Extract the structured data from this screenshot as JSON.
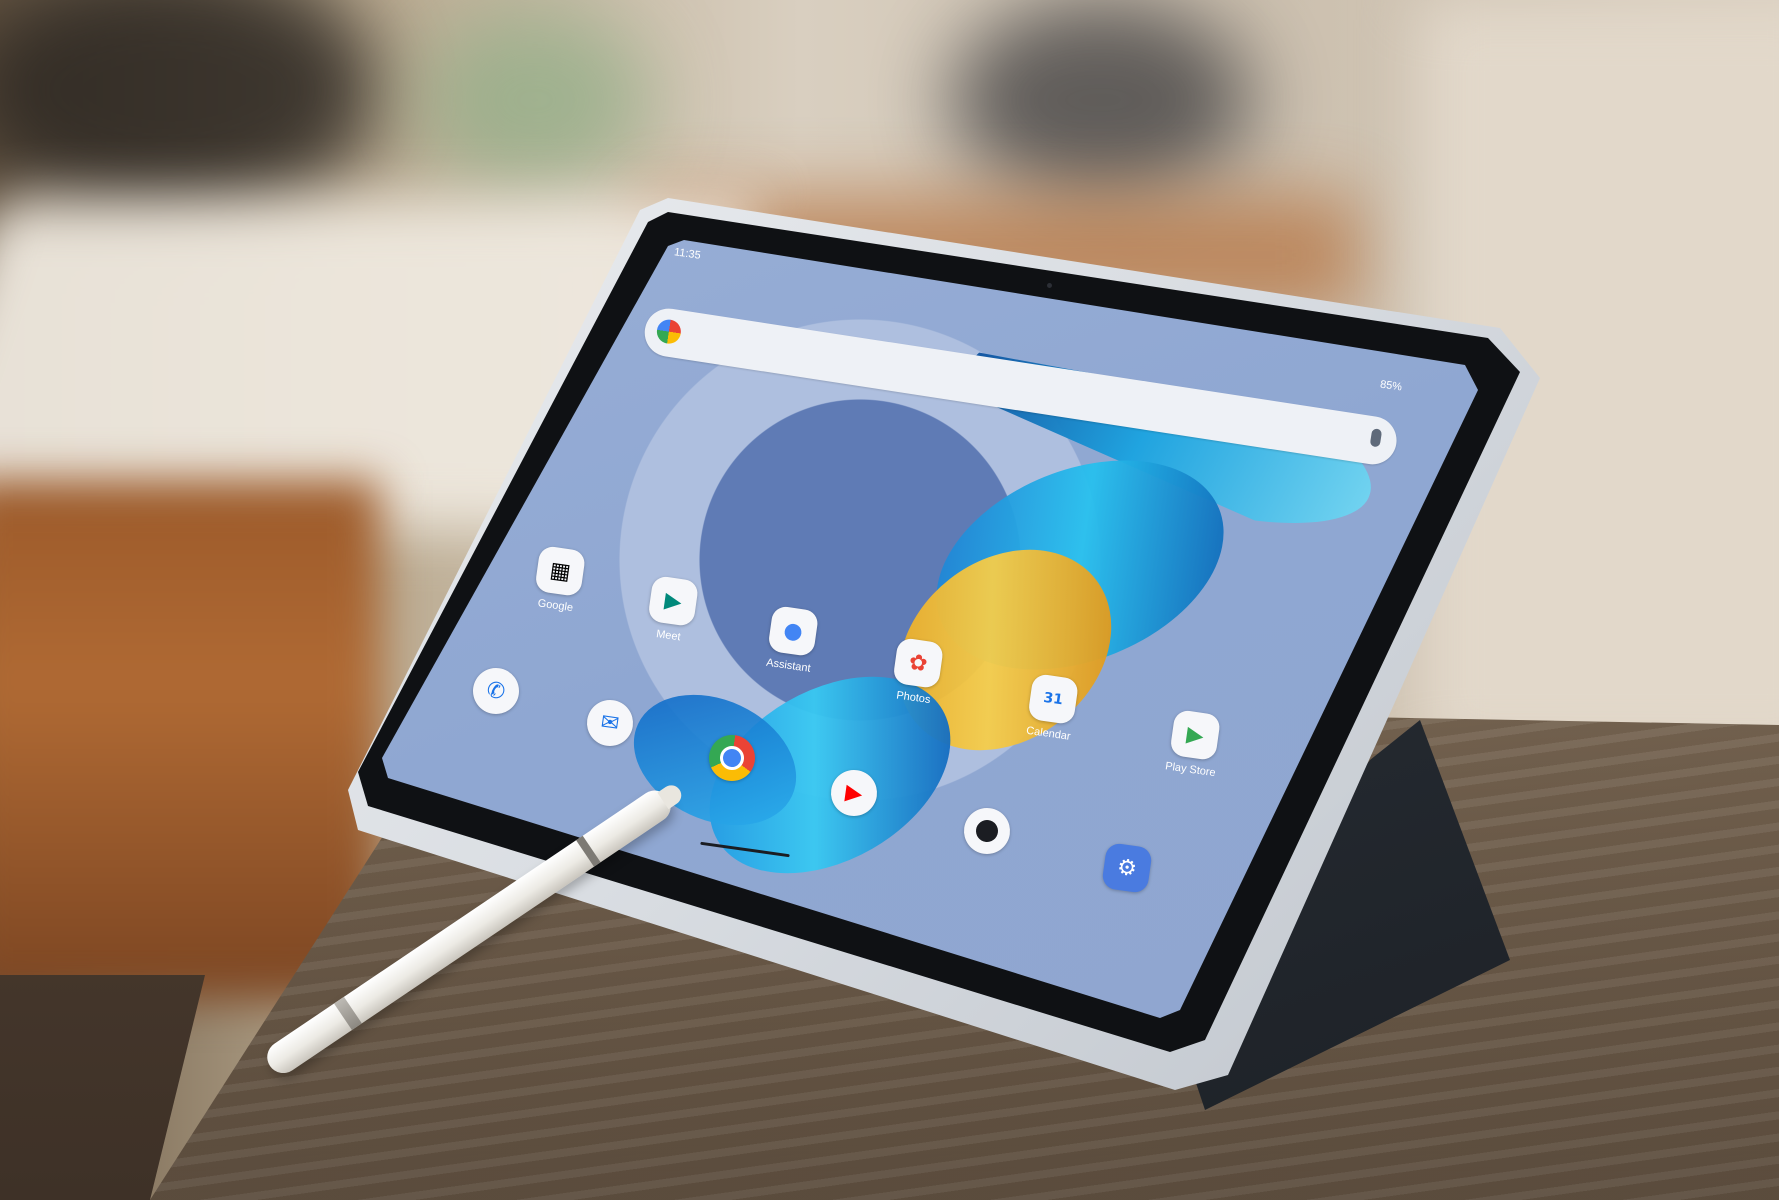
{
  "status_bar": {
    "time": "11:35",
    "battery": "85%"
  },
  "apps": [
    {
      "id": "google",
      "label": "Google",
      "icon": "google-folder-icon"
    },
    {
      "id": "meet",
      "label": "Meet",
      "icon": "meet-icon"
    },
    {
      "id": "assistant",
      "label": "Assistant",
      "icon": "assistant-icon"
    },
    {
      "id": "photos",
      "label": "Photos",
      "icon": "photos-icon"
    },
    {
      "id": "calendar",
      "label": "Calendar",
      "icon": "calendar-icon"
    },
    {
      "id": "playstore",
      "label": "Play Store",
      "icon": "play-store-icon"
    }
  ],
  "dock": [
    {
      "id": "phone",
      "icon": "phone-icon"
    },
    {
      "id": "messages",
      "icon": "messages-icon"
    },
    {
      "id": "chrome",
      "icon": "chrome-icon"
    },
    {
      "id": "youtube",
      "icon": "youtube-icon"
    },
    {
      "id": "camera",
      "icon": "camera-icon"
    },
    {
      "id": "settings",
      "icon": "settings-icon"
    }
  ],
  "calendar_day": "31",
  "colors": {
    "screen_bg": "#90a6cf",
    "feather_blue": "#1aa3e0",
    "feather_gold": "#f5cd4a",
    "settings_blue": "#4a7be0"
  }
}
